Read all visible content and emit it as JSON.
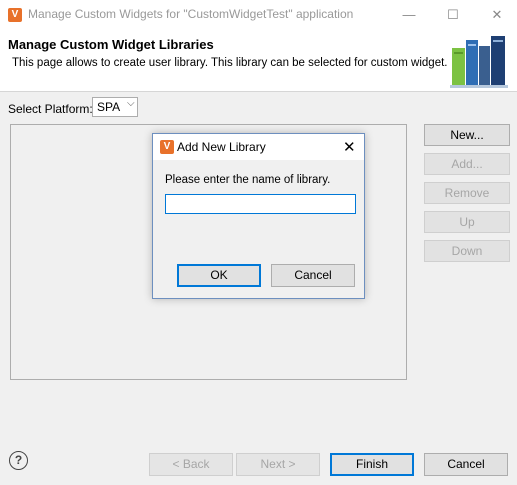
{
  "window": {
    "title": "Manage Custom Widgets for \"CustomWidgetTest\" application",
    "app_icon_glyph": "V",
    "minimize_glyph": "—",
    "maximize_glyph": "☐",
    "close_glyph": "✕"
  },
  "header": {
    "title": "Manage Custom Widget Libraries",
    "description": "This page allows to create user library. This library can be selected for custom widget."
  },
  "platform": {
    "label": "Select Platform:",
    "selected": "SPA",
    "chevron": "⌵"
  },
  "side_buttons": {
    "new": "New...",
    "add": "Add...",
    "remove": "Remove",
    "up": "Up",
    "down": "Down"
  },
  "footer": {
    "help_glyph": "?",
    "back": "< Back",
    "next": "Next >",
    "finish": "Finish",
    "cancel": "Cancel"
  },
  "dialog": {
    "icon_glyph": "V",
    "title": "Add New Library",
    "close_glyph": "✕",
    "message": "Please enter the name of library.",
    "input_value": "",
    "ok": "OK",
    "cancel": "Cancel"
  },
  "colors": {
    "accent": "#0078d7",
    "app_icon": "#e8712a",
    "disabled_text": "#a6a6a6"
  }
}
